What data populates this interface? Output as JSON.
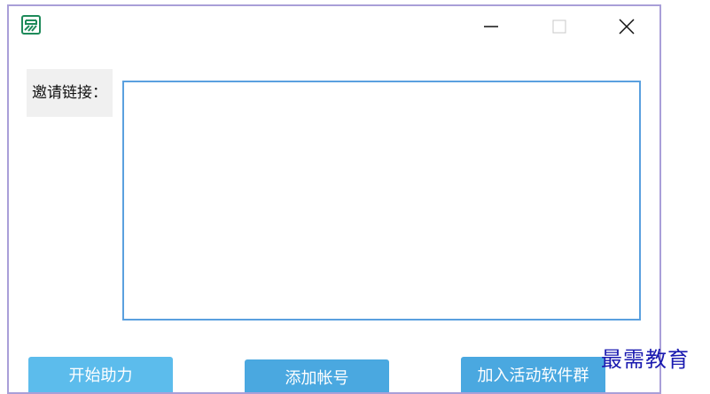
{
  "window": {
    "app_icon": "app-logo-icon",
    "controls": {
      "minimize_icon": "minimize-icon",
      "maximize_icon": "maximize-icon",
      "close_icon": "close-icon"
    },
    "border_color": "#a99fd8"
  },
  "form": {
    "invite_label": "邀请链接：",
    "invite_value": ""
  },
  "actions": {
    "start_label": "开始助力",
    "add_label": "添加帐号",
    "join_label": "加入活动软件群"
  },
  "colors": {
    "button_primary": "#4aa8e0",
    "button_light": "#5cbcec",
    "input_border": "#5aa0df",
    "logo_green": "#1e8a5a"
  },
  "watermark": "最需教育"
}
